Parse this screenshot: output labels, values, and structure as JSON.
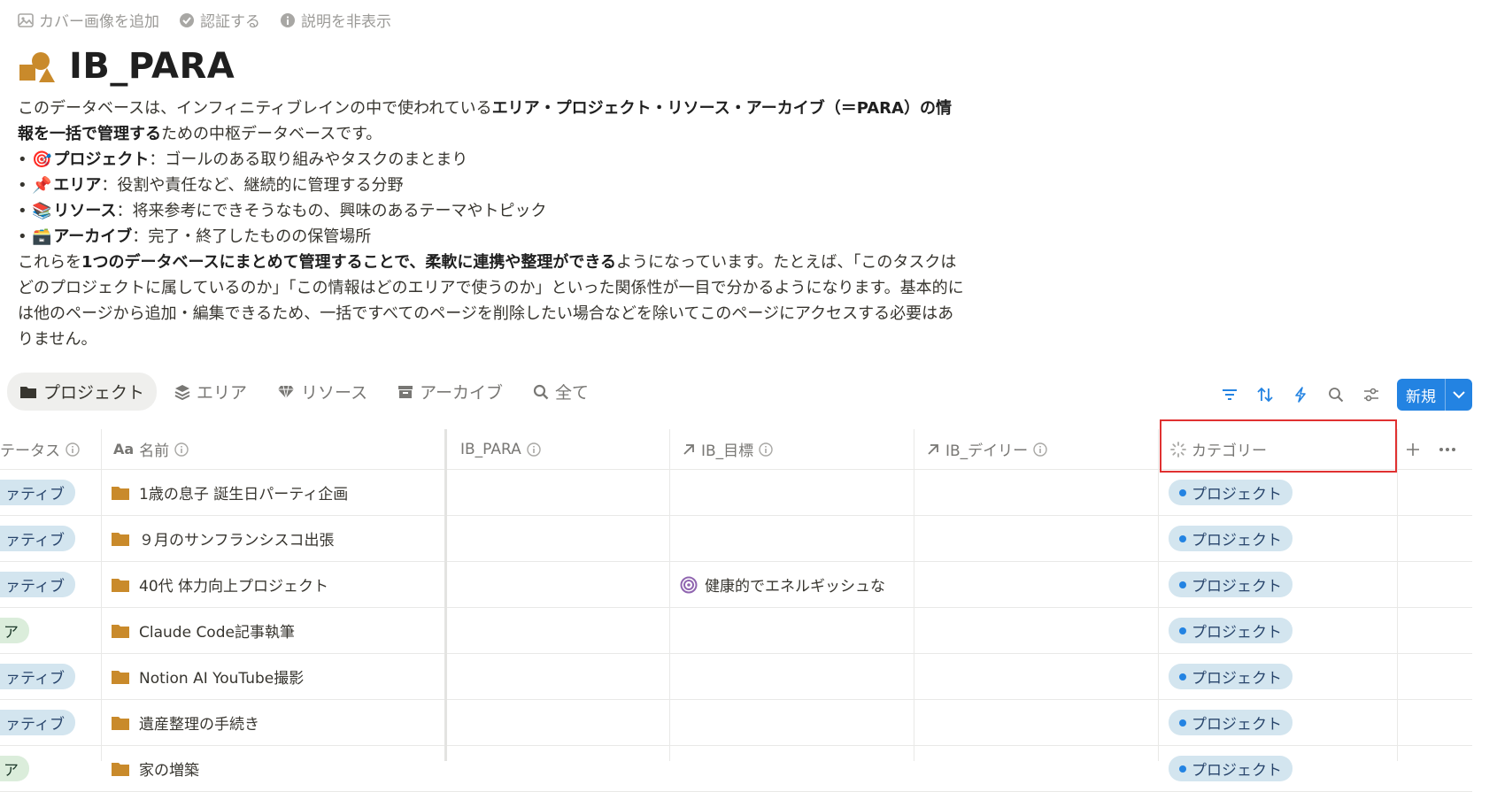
{
  "top_actions": {
    "add_cover": "カバー画像を追加",
    "verify": "認証する",
    "hide_description": "説明を非表示"
  },
  "page": {
    "title": "IB_PARA"
  },
  "description": {
    "line1_prefix": "このデータベースは、インフィニティブレインの中で使われている",
    "line1_bold": "エリア・プロジェクト・リソース・アーカイブ（＝PARA）の情報を一括で管理する",
    "line1_suffix": "ための中枢データベースです。",
    "bullets": [
      {
        "emoji": "🎯",
        "term": "プロジェクト",
        "text": "：ゴールのある取り組みやタスクのまとまり"
      },
      {
        "emoji": "📌",
        "term": "エリア",
        "text": "：役割や責任など、継続的に管理する分野"
      },
      {
        "emoji": "📚",
        "term": "リソース",
        "text": "：将来参考にできそうなもの、興味のあるテーマやトピック"
      },
      {
        "emoji": "🗃️",
        "term": "アーカイブ",
        "text": "：完了・終了したものの保管場所"
      }
    ],
    "closing_prefix": "これらを",
    "closing_bold": "1つのデータベースにまとめて管理することで、柔軟に連携や整理ができる",
    "closing_suffix": "ようになっています。たとえば、「このタスクはどのプロジェクトに属しているのか」「この情報はどのエリアで使うのか」といった関係性が一目で分かるようになります。基本的には他のページから追加・編集できるため、一括ですべてのページを削除したい場合などを除いてこのページにアクセスする必要はありません。"
  },
  "views": [
    {
      "label": "プロジェクト",
      "icon": "folder-icon",
      "active": true
    },
    {
      "label": "エリア",
      "icon": "layers-icon",
      "active": false
    },
    {
      "label": "リソース",
      "icon": "gem-icon",
      "active": false
    },
    {
      "label": "アーカイブ",
      "icon": "archive-icon",
      "active": false
    },
    {
      "label": "全て",
      "icon": "search-icon",
      "active": false
    }
  ],
  "toolbar": {
    "new_label": "新規"
  },
  "columns": {
    "status": "テータス",
    "name": "名前",
    "para": "IB_PARA",
    "goal": "IB_目標",
    "daily": "IB_デイリー",
    "category": "カテゴリー"
  },
  "rows": [
    {
      "status": "ァティブ",
      "status_type": "active",
      "name": "1歳の息子 誕生日パーティ企画",
      "goal": "",
      "category": "プロジェクト"
    },
    {
      "status": "ァティブ",
      "status_type": "active",
      "name": "９月のサンフランシスコ出張",
      "goal": "",
      "category": "プロジェクト"
    },
    {
      "status": "ァティブ",
      "status_type": "active",
      "name": "40代 体力向上プロジェクト",
      "goal": "健康的でエネルギッシュな",
      "category": "プロジェクト"
    },
    {
      "status": "ア",
      "status_type": "done",
      "name": "Claude Code記事執筆",
      "goal": "",
      "category": "プロジェクト"
    },
    {
      "status": "ァティブ",
      "status_type": "active",
      "name": "Notion AI YouTube撮影",
      "goal": "",
      "category": "プロジェクト"
    },
    {
      "status": "ァティブ",
      "status_type": "active",
      "name": "遺産整理の手続き",
      "goal": "",
      "category": "プロジェクト"
    },
    {
      "status": "ア",
      "status_type": "done",
      "name": "家の増築",
      "goal": "",
      "category": "プロジェクト"
    }
  ],
  "colors": {
    "accent": "#2383e2",
    "icon_gold": "#c98a2b",
    "highlight": "#e03131"
  }
}
